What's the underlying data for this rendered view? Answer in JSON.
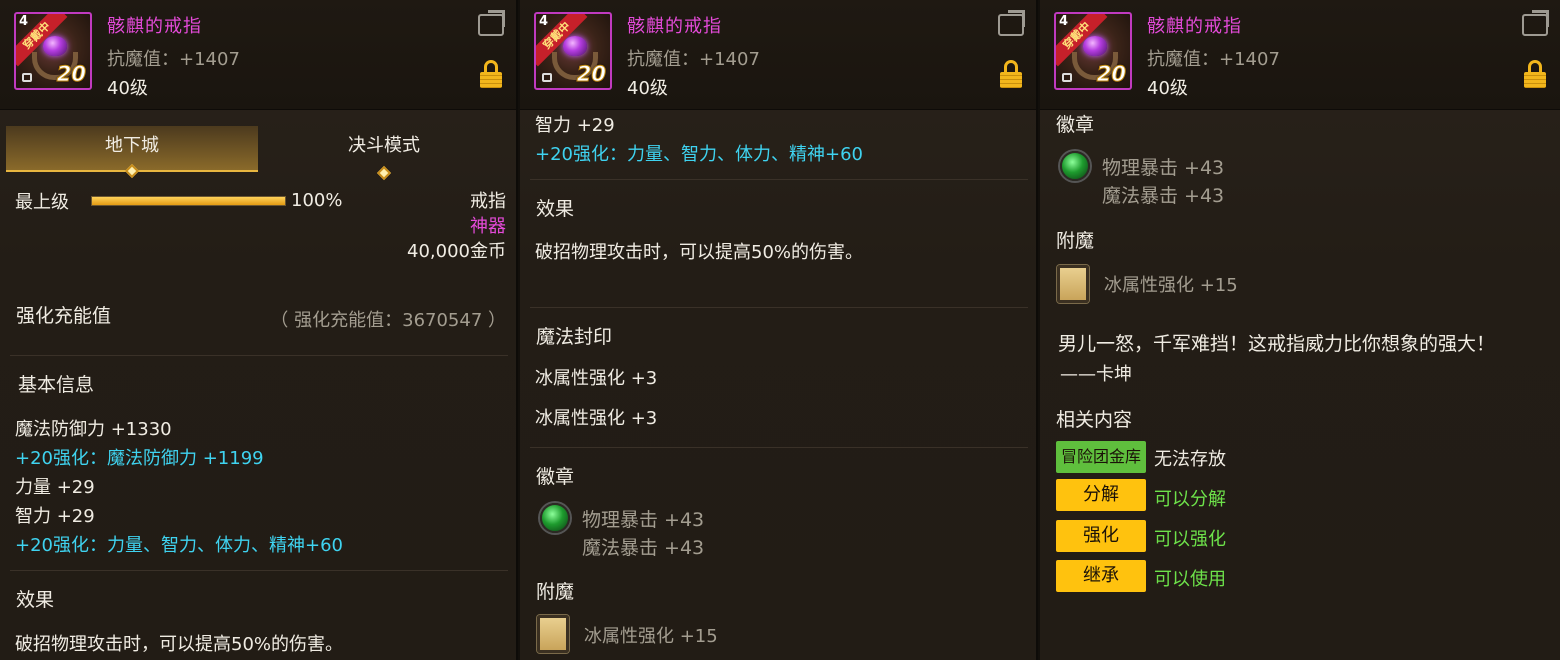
{
  "item": {
    "name": "骸麒的戒指",
    "stat": "抗魔值：+1407",
    "level": "40级",
    "icon_ribbon": "穿戴中",
    "icon_corner": "4",
    "icon_upgrade": "20"
  },
  "icons": {
    "share": "share-icon",
    "lock": "lock-icon",
    "emblem": "green-gem-icon",
    "enchant": "card-icon"
  },
  "colors": {
    "item_name": "#e34ad8",
    "cyan_text": "#3fd3f0",
    "green_text": "#6de24a",
    "lock_gold": "#f2b61c",
    "tag_green": "#5fbf3d",
    "tag_yellow": "#ffc20e"
  },
  "panel1": {
    "tabs": [
      "地下城",
      "决斗模式"
    ],
    "active_tab": "地下城",
    "grade_label": "最上级",
    "grade_value": 1.0,
    "grade_percent": "100%",
    "slot": "戒指",
    "rarity": "神器",
    "price": "40,000金币",
    "charge_title": "强化充能值",
    "charge_value": "（ 强化充能值：3670547 ）",
    "basic_title": "基本信息",
    "basic_lines": [
      "魔法防御力 +1330",
      "+20强化：魔法防御力 +1199",
      "力量 +29",
      "智力 +29",
      "+20强化：力量、智力、体力、精神+60"
    ],
    "effect_title": "效果",
    "effect_text": "破招物理攻击时，可以提高50%的伤害。"
  },
  "panel2": {
    "top_lines": [
      "智力 +29",
      "+20强化：力量、智力、体力、精神+60"
    ],
    "effect_title": "效果",
    "effect_text": "破招物理攻击时，可以提高50%的伤害。",
    "seal_title": "魔法封印",
    "seal_lines": [
      "冰属性强化 +3",
      "冰属性强化 +3"
    ],
    "emblem_title": "徽章",
    "emblem_lines": [
      "物理暴击 +43",
      "魔法暴击 +43"
    ],
    "enchant_title": "附魔",
    "enchant_text": "冰属性强化 +15"
  },
  "panel3": {
    "emblem_title": "徽章",
    "emblem_lines": [
      "物理暴击 +43",
      "魔法暴击 +43"
    ],
    "enchant_title": "附魔",
    "enchant_text": "冰属性强化 +15",
    "flavor_text": "男儿一怒，千军难挡！这戒指威力比你想象的强大！",
    "flavor_author": "——卡坤",
    "related_title": "相关内容",
    "related": [
      {
        "tag": "冒险团金库",
        "status": "无法存放"
      },
      {
        "tag": "分解",
        "status": "可以分解"
      },
      {
        "tag": "强化",
        "status": "可以强化"
      },
      {
        "tag": "继承",
        "status": "可以使用"
      }
    ]
  }
}
